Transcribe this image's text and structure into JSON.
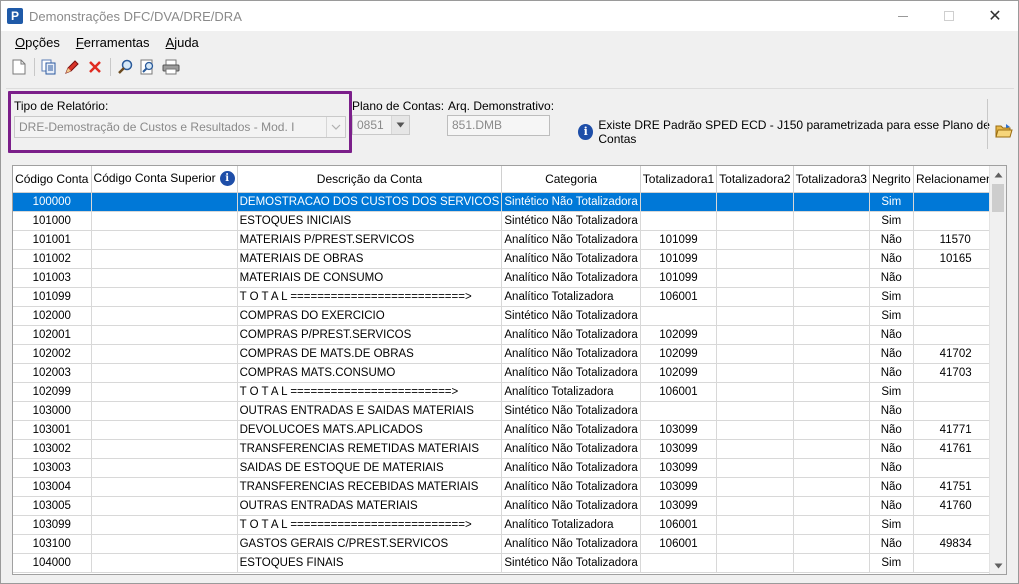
{
  "window": {
    "title": "Demonstrações DFC/DVA/DRE/DRA",
    "app_icon": "P"
  },
  "menu": [
    "Opções",
    "Ferramentas",
    "Ajuda"
  ],
  "toolbar_icons": [
    "new-document-icon",
    "copy-icon",
    "edit-pencil-icon",
    "delete-x-icon",
    "search-icon",
    "find-next-icon",
    "print-icon"
  ],
  "form": {
    "tipo_label": "Tipo de Relatório:",
    "tipo_value": "DRE-Demostração de Custos e Resultados - Mod. I",
    "plano_label": "Plano de Contas:",
    "plano_value": "0851",
    "arq_label": "Arq. Demonstrativo:",
    "arq_value": "851.DMB",
    "info_text": "Existe DRE Padrão SPED ECD - J150 parametrizada para esse Plano de Contas"
  },
  "colors": {
    "selection": "#0078d7",
    "highlight_border": "#7b1f8a",
    "info_icon": "#1e4ea8"
  },
  "table": {
    "headers": [
      "Código Conta",
      "Código Conta Superior",
      "Descrição da Conta",
      "Categoria",
      "Totalizadora1",
      "Totalizadora2",
      "Totalizadora3",
      "Negrito",
      "Relacionamento"
    ],
    "rows": [
      [
        "100000",
        "",
        "DEMOSTRACAO DOS CUSTOS DOS SERVICOS",
        "Sintético Não Totalizadora",
        "",
        "",
        "",
        "Sim",
        ""
      ],
      [
        "101000",
        "",
        "ESTOQUES INICIAIS",
        "Sintético Não Totalizadora",
        "",
        "",
        "",
        "Sim",
        ""
      ],
      [
        "101001",
        "",
        "MATERIAIS P/PREST.SERVICOS",
        "Analítico Não Totalizadora",
        "101099",
        "",
        "",
        "Não",
        "11570"
      ],
      [
        "101002",
        "",
        "MATERIAIS DE OBRAS",
        "Analítico Não Totalizadora",
        "101099",
        "",
        "",
        "Não",
        "10165"
      ],
      [
        "101003",
        "",
        "MATERIAIS DE CONSUMO",
        "Analítico Não Totalizadora",
        "101099",
        "",
        "",
        "Não",
        ""
      ],
      [
        "101099",
        "",
        "T O T A L ==========================>",
        "Analítico Totalizadora",
        "106001",
        "",
        "",
        "Sim",
        ""
      ],
      [
        "102000",
        "",
        "COMPRAS DO EXERCICIO",
        "Sintético Não Totalizadora",
        "",
        "",
        "",
        "Sim",
        ""
      ],
      [
        "102001",
        "",
        "COMPRAS P/PREST.SERVICOS",
        "Analítico Não Totalizadora",
        "102099",
        "",
        "",
        "Não",
        ""
      ],
      [
        "102002",
        "",
        "COMPRAS DE MATS.DE OBRAS",
        "Analítico Não Totalizadora",
        "102099",
        "",
        "",
        "Não",
        "41702"
      ],
      [
        "102003",
        "",
        "COMPRAS MATS.CONSUMO",
        "Analítico Não Totalizadora",
        "102099",
        "",
        "",
        "Não",
        "41703"
      ],
      [
        "102099",
        "",
        "T O T A L ========================>",
        "Analítico Totalizadora",
        "106001",
        "",
        "",
        "Sim",
        ""
      ],
      [
        "103000",
        "",
        "OUTRAS ENTRADAS E SAIDAS MATERIAIS",
        "Sintético Não Totalizadora",
        "",
        "",
        "",
        "Não",
        ""
      ],
      [
        "103001",
        "",
        "DEVOLUCOES MATS.APLICADOS",
        "Analítico Não Totalizadora",
        "103099",
        "",
        "",
        "Não",
        "41771"
      ],
      [
        "103002",
        "",
        "TRANSFERENCIAS REMETIDAS MATERIAIS",
        "Analítico Não Totalizadora",
        "103099",
        "",
        "",
        "Não",
        "41761"
      ],
      [
        "103003",
        "",
        "SAIDAS DE ESTOQUE DE MATERIAIS",
        "Analítico Não Totalizadora",
        "103099",
        "",
        "",
        "Não",
        ""
      ],
      [
        "103004",
        "",
        "TRANSFERENCIAS RECEBIDAS MATERIAIS",
        "Analítico Não Totalizadora",
        "103099",
        "",
        "",
        "Não",
        "41751"
      ],
      [
        "103005",
        "",
        "OUTRAS ENTRADAS MATERIAIS",
        "Analítico Não Totalizadora",
        "103099",
        "",
        "",
        "Não",
        "41760"
      ],
      [
        "103099",
        "",
        "T O T A L ==========================>",
        "Analítico Totalizadora",
        "106001",
        "",
        "",
        "Sim",
        ""
      ],
      [
        "103100",
        "",
        "GASTOS GERAIS C/PREST.SERVICOS",
        "Analítico Não Totalizadora",
        "106001",
        "",
        "",
        "Não",
        "49834"
      ],
      [
        "104000",
        "",
        "ESTOQUES FINAIS",
        "Sintético Não Totalizadora",
        "",
        "",
        "",
        "Sim",
        ""
      ]
    ]
  }
}
